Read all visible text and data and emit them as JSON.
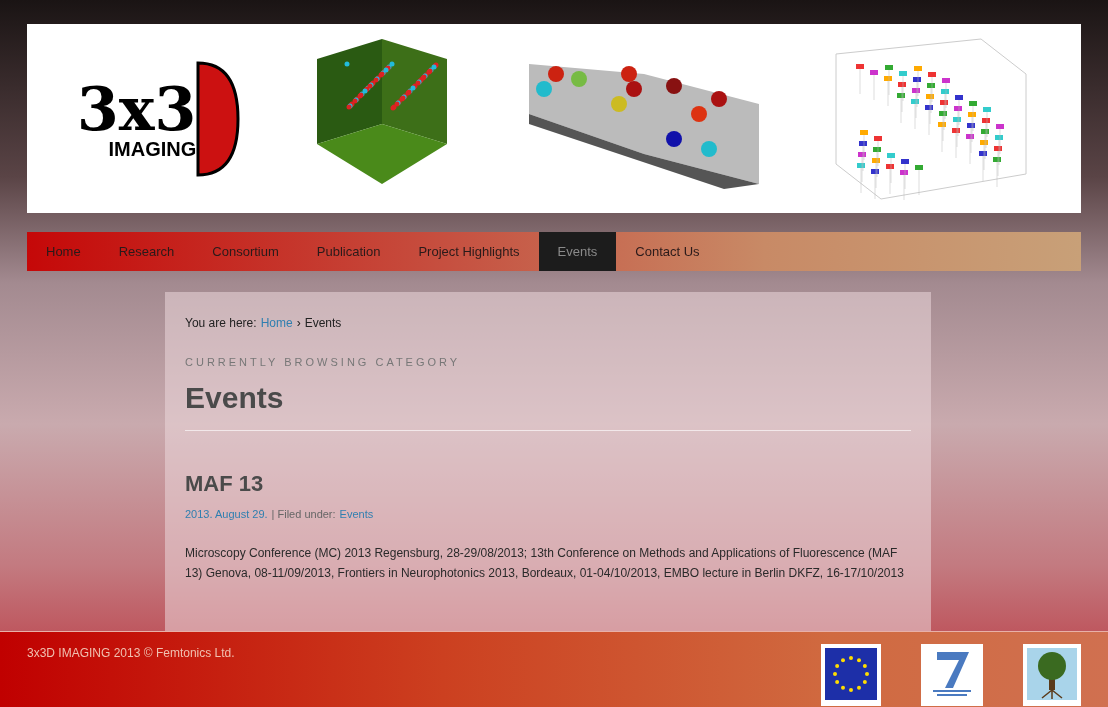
{
  "logo": {
    "main": "3x3",
    "sub": "IMAGING"
  },
  "nav": [
    {
      "label": "Home",
      "selected": false
    },
    {
      "label": "Research",
      "selected": false
    },
    {
      "label": "Consortium",
      "selected": false
    },
    {
      "label": "Publication",
      "selected": false
    },
    {
      "label": "Project Highlights",
      "selected": false
    },
    {
      "label": "Events",
      "selected": true
    },
    {
      "label": "Contact Us",
      "selected": false
    }
  ],
  "breadcrumb": {
    "prefix": "You are here:",
    "link": "Home",
    "separator": "›",
    "current": "Events"
  },
  "category_label": "CURRENTLY BROWSING CATEGORY",
  "page_title": "Events",
  "post": {
    "title": "MAF 13",
    "date": "2013. August 29.",
    "filed_label": "| Filed under:",
    "category": "Events",
    "body": "Microscopy Conference (MC) 2013 Regensburg, 28-29/08/2013; 13th Conference on Methods and Applications of Fluorescence (MAF 13) Genova, 08-11/09/2013, Frontiers in Neurophotonics 2013, Bordeaux, 01-04/10/2013, EMBO lecture in Berlin DKFZ, 16-17/10/2013"
  },
  "footer": {
    "copyright": "3x3D IMAGING 2013 © Femtonics Ltd."
  }
}
